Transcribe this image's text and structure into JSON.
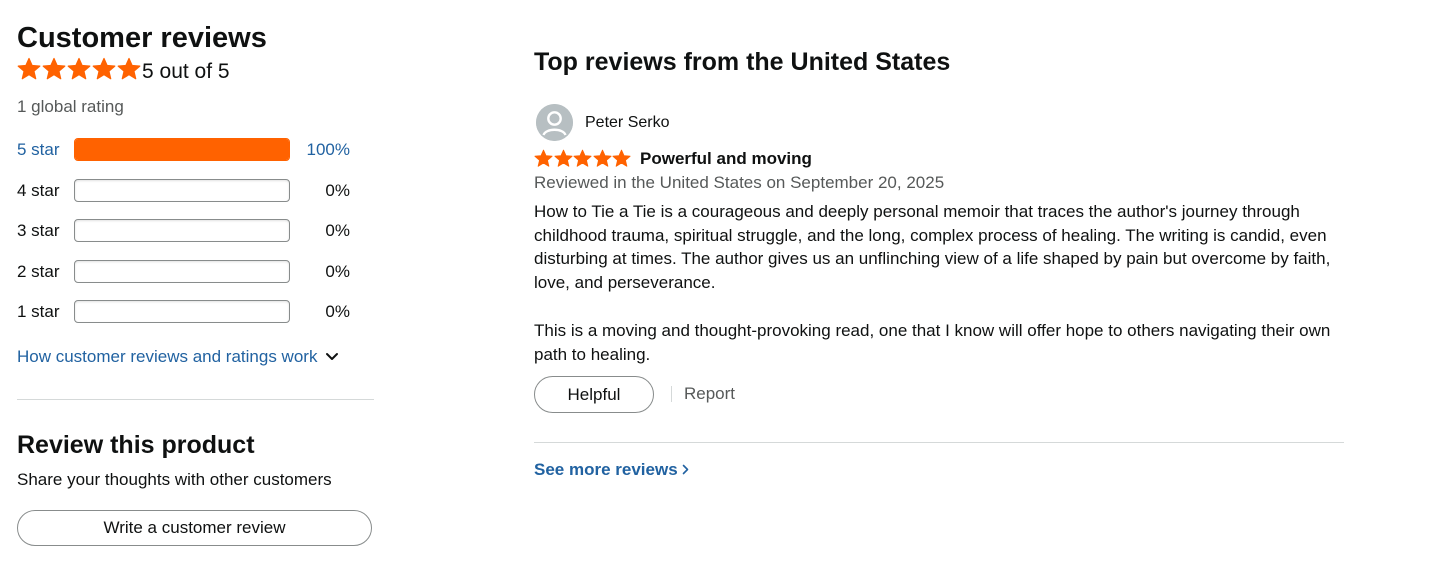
{
  "colors": {
    "star": "#ff6200",
    "link": "#2162a1",
    "text": "#0f1111",
    "muted": "#565959",
    "border": "#888c8c",
    "divider": "#d5d9d9"
  },
  "summary": {
    "title": "Customer reviews",
    "rating_value": 5,
    "rating_max": 5,
    "rating_text": "5 out of 5",
    "global_rating": "1 global rating"
  },
  "histogram": [
    {
      "label": "5 star",
      "percent": 100,
      "percent_text": "100%"
    },
    {
      "label": "4 star",
      "percent": 0,
      "percent_text": "0%"
    },
    {
      "label": "3 star",
      "percent": 0,
      "percent_text": "0%"
    },
    {
      "label": "2 star",
      "percent": 0,
      "percent_text": "0%"
    },
    {
      "label": "1 star",
      "percent": 0,
      "percent_text": "0%"
    }
  ],
  "how_reviews_work": {
    "label": "How customer reviews and ratings work",
    "icon": "chevron-down-icon"
  },
  "review_product": {
    "title": "Review this product",
    "subtitle": "Share your thoughts with other customers",
    "button_label": "Write a customer review"
  },
  "top_reviews": {
    "title": "Top reviews from the United States",
    "review": {
      "reviewer": "Peter Serko",
      "avatar_icon": "user-avatar-icon",
      "stars": 5,
      "title": "Powerful and moving",
      "meta": "Reviewed in the United States on September 20, 2025",
      "paragraphs": [
        "How to Tie a Tie is a courageous and deeply personal memoir that traces the author's journey through childhood trauma, spiritual struggle, and the long, complex process of healing. The writing is candid, even disturbing at times. The author gives us an unflinching view of a life shaped by pain but overcome by faith, love, and perseverance.",
        "This is a moving and thought-provoking read, one that I know will offer hope to others navigating their own path to healing."
      ],
      "helpful_label": "Helpful",
      "report_label": "Report"
    },
    "see_more_label": "See more reviews",
    "see_more_icon": "chevron-right-icon"
  }
}
